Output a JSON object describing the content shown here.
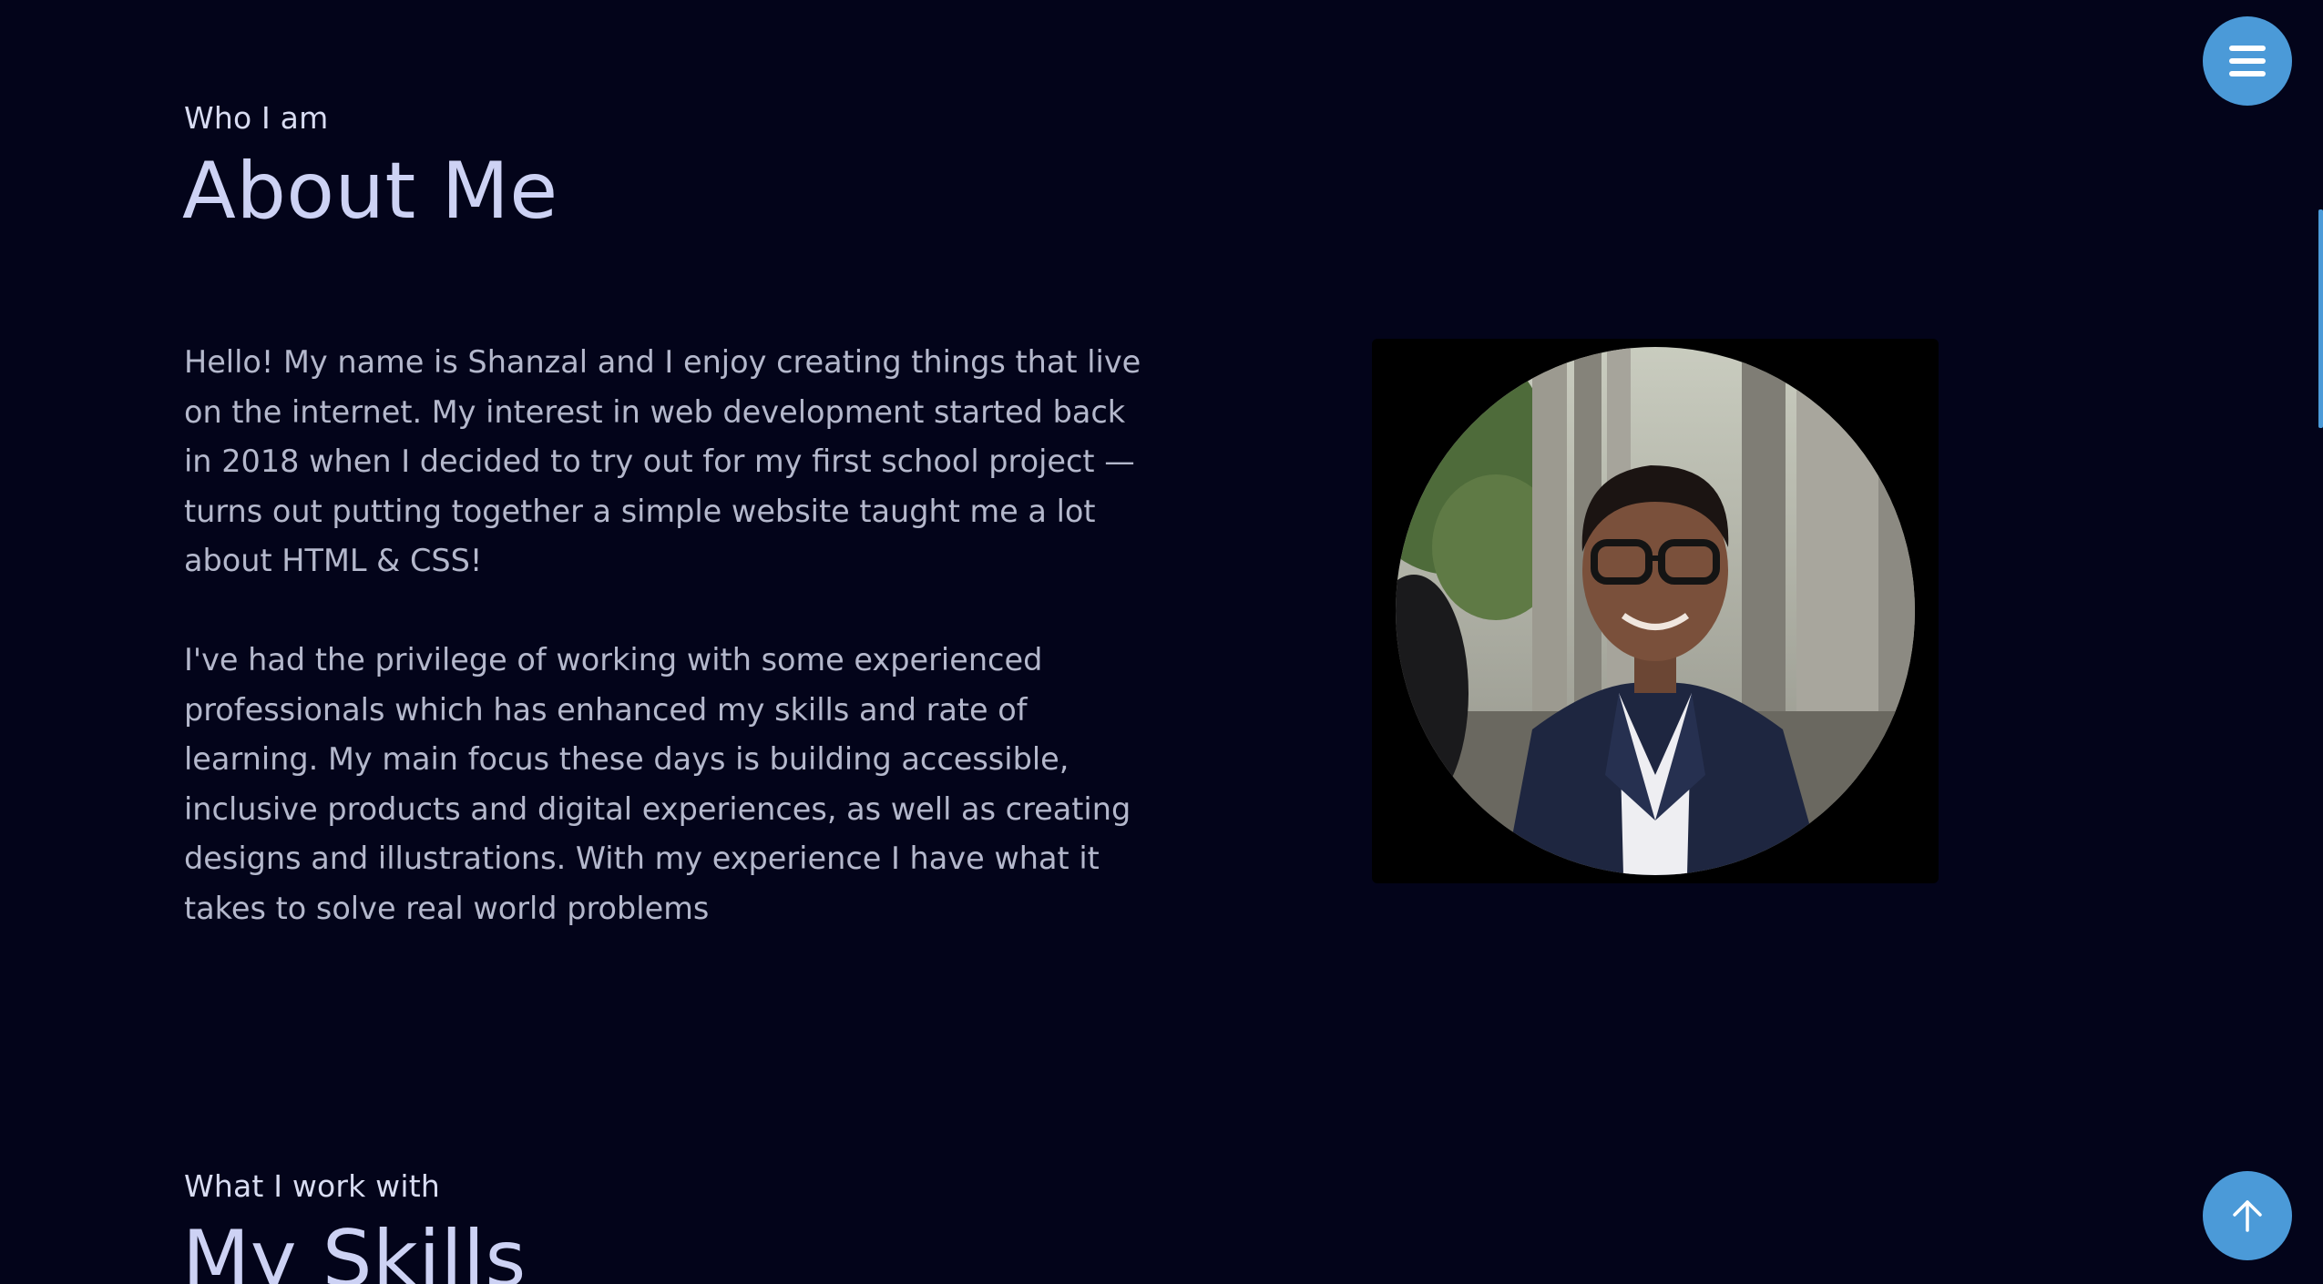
{
  "about": {
    "eyebrow": "Who I am",
    "title": "About Me",
    "paragraphs": [
      "Hello! My name is Shanzal and I enjoy creating things that live on the internet. My interest in web development started back in 2018 when I decided to try out for my first school project — turns out putting together a simple website taught me a lot about HTML & CSS!",
      "I've had the privilege of working with some experienced professionals which has enhanced my skills and rate of learning. My main focus these days is building accessible, inclusive products and digital experiences, as well as creating designs and illustrations. With my experience I have what it takes to solve real world problems"
    ]
  },
  "skills": {
    "eyebrow": "What I work with",
    "title": "My Skills"
  },
  "icons": {
    "menu": "hamburger-menu-icon",
    "back_to_top": "arrow-up-icon"
  },
  "colors": {
    "background": "#03041a",
    "accent": "#4b9ad8",
    "heading": "#cdd2f4",
    "body_text": "#b4b8cc"
  }
}
